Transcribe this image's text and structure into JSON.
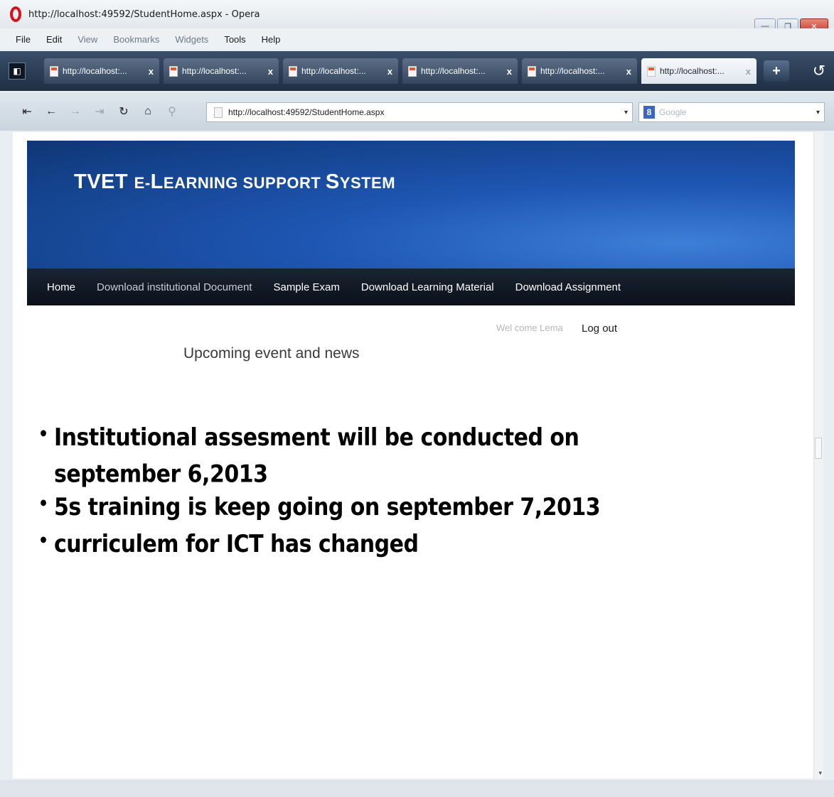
{
  "window": {
    "title": "http://localhost:49592/StudentHome.aspx - Opera",
    "controls": {
      "minimize": "—",
      "maximize": "❐",
      "close": "✕"
    }
  },
  "menu": [
    "File",
    "Edit",
    "View",
    "Bookmarks",
    "Widgets",
    "Tools",
    "Help"
  ],
  "tabs": [
    {
      "label": "http://localhost:..."
    },
    {
      "label": "http://localhost:..."
    },
    {
      "label": "http://localhost:..."
    },
    {
      "label": "http://localhost:..."
    },
    {
      "label": "http://localhost:..."
    },
    {
      "label": "http://localhost:..."
    }
  ],
  "tab_close_glyph": "x",
  "new_tab_glyph": "+",
  "toolbar": {
    "url": "http://localhost:49592/StudentHome.aspx",
    "search_engine_letter": "8",
    "search_placeholder": "Google"
  },
  "site": {
    "title_big1": "TVET ",
    "title_small1": "E-",
    "title_big2": "L",
    "title_small2": "EARNING SUPPORT ",
    "title_big3": "S",
    "title_small3": "YSTEM",
    "nav": [
      "Home",
      "Download institutional Document",
      "Sample Exam",
      "Download Learning Material",
      "Download Assignment"
    ],
    "welcome": "Wel come Lema",
    "logout": "Log out",
    "news_heading": "Upcoming event and news",
    "news": [
      "Institutional assesment will be conducted on september 6,2013",
      "5s training is keep going on september 7,2013",
      "curriculem for ICT has changed"
    ]
  },
  "icons": {
    "back_to_start": "⇤",
    "back": "←",
    "forward": "→",
    "fast_forward": "⇥",
    "reload": "↻",
    "home": "⌂",
    "wand": "⚲",
    "panel_toggle": "◧",
    "closed_tabs": "↺",
    "dropdown": "▾",
    "bullet": "•"
  }
}
